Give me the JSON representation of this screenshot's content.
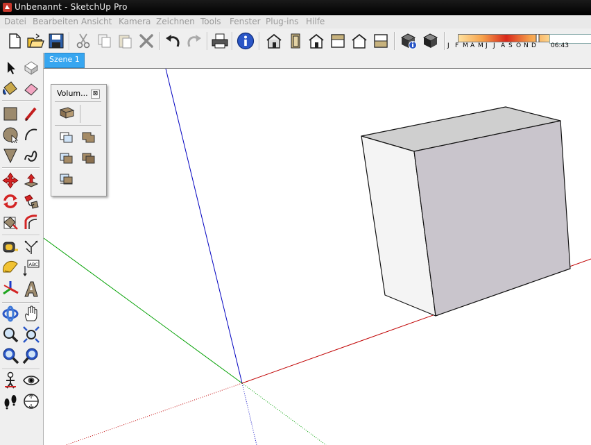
{
  "window": {
    "title": "Unbenannt - SketchUp Pro"
  },
  "menu": [
    "Datei",
    "Bearbeiten",
    "Ansicht",
    "Kamera",
    "Zeichnen",
    "Tools",
    "Fenster",
    "Plug-ins",
    "Hilfe"
  ],
  "shadow": {
    "months": [
      "J",
      "F",
      "M",
      "A",
      "M",
      "J",
      "J",
      "A",
      "S",
      "O",
      "N",
      "D"
    ],
    "time": "06:43"
  },
  "scene_tab": "Szene 1",
  "palette": {
    "title": "Volum...",
    "close": "⊠"
  },
  "toolbar_icons": [
    "new-file-icon",
    "open-folder-icon",
    "save-icon",
    "cut-icon",
    "copy-icon",
    "paste-icon",
    "delete-icon",
    "undo-icon",
    "redo-icon",
    "print-icon",
    "model-info-icon",
    "iso-view-icon",
    "top-view-icon",
    "front-view-icon",
    "right-view-icon",
    "back-view-icon",
    "left-view-icon",
    "geo-location-icon",
    "photo-texture-icon"
  ],
  "left_tools": [
    "select-icon",
    "make-component-icon",
    "paint-bucket-icon",
    "eraser-icon",
    "rectangle-icon",
    "line-icon",
    "circle-icon",
    "arc-icon",
    "polygon-icon",
    "freehand-icon",
    "move-icon",
    "push-pull-icon",
    "rotate-icon",
    "follow-me-icon",
    "scale-icon",
    "offset-icon",
    "tape-measure-icon",
    "dimension-icon",
    "protractor-icon",
    "text-icon",
    "axes-icon",
    "3d-text-icon",
    "orbit-icon",
    "pan-icon",
    "zoom-icon",
    "zoom-window-icon",
    "zoom-extents-icon",
    "previous-view-icon",
    "position-camera-icon",
    "look-around-icon",
    "walk-icon",
    "section-plane-icon"
  ],
  "colors": {
    "accent": "#37a6f0",
    "red_axis": "#c00000",
    "green_axis": "#00a000",
    "blue_axis": "#0000c0",
    "box_top": "#cfcfcf",
    "box_front": "#f4f4f4",
    "box_side": "#c9c5cc"
  }
}
